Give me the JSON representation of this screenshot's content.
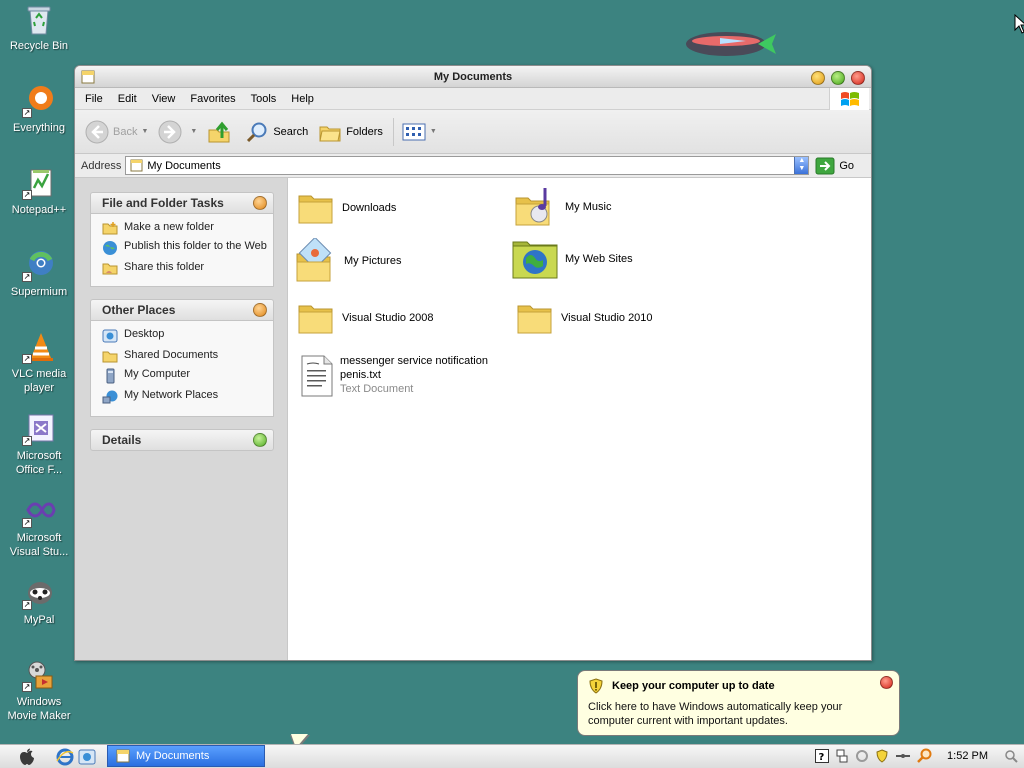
{
  "desktop": {
    "icons": [
      {
        "label": "Recycle Bin",
        "icon": "recycle-bin-icon"
      },
      {
        "label": "Everything",
        "icon": "everything-icon"
      },
      {
        "label": "Notepad++",
        "icon": "notepadpp-icon"
      },
      {
        "label": "Supermium",
        "icon": "supermium-icon"
      },
      {
        "label": "VLC media player",
        "icon": "vlc-icon"
      },
      {
        "label": "Microsoft Office F...",
        "icon": "office-icon"
      },
      {
        "label": "Microsoft Visual Stu...",
        "icon": "visual-studio-icon"
      },
      {
        "label": "MyPal",
        "icon": "mypal-icon"
      },
      {
        "label": "Windows Movie Maker",
        "icon": "movie-maker-icon"
      }
    ]
  },
  "window": {
    "title": "My Documents",
    "menu": [
      "File",
      "Edit",
      "View",
      "Favorites",
      "Tools",
      "Help"
    ],
    "toolbar": {
      "back": "Back",
      "search": "Search",
      "folders": "Folders"
    },
    "address": {
      "label": "Address",
      "value": "My Documents",
      "go": "Go"
    },
    "tasks": {
      "file_folder": {
        "title": "File and Folder Tasks",
        "items": [
          "Make a new folder",
          "Publish this folder to the Web",
          "Share this folder"
        ]
      },
      "other_places": {
        "title": "Other Places",
        "items": [
          "Desktop",
          "Shared Documents",
          "My Computer",
          "My Network Places"
        ]
      },
      "details": {
        "title": "Details"
      }
    },
    "files": [
      {
        "name": "Downloads",
        "icon": "folder-icon"
      },
      {
        "name": "My Music",
        "icon": "music-folder-icon"
      },
      {
        "name": "My Pictures",
        "icon": "pictures-folder-icon"
      },
      {
        "name": "My Web Sites",
        "icon": "web-sites-folder-icon"
      },
      {
        "name": "Visual Studio 2008",
        "icon": "folder-icon"
      },
      {
        "name": "Visual Studio 2010",
        "icon": "folder-icon"
      },
      {
        "name": "messenger service notification penis.txt",
        "type": "Text Document",
        "icon": "text-document-icon"
      }
    ]
  },
  "balloon": {
    "title": "Keep your computer up to date",
    "text": "Click here to have Windows automatically keep your computer current with important updates."
  },
  "taskbar": {
    "active_task": "My Documents",
    "clock": "1:52 PM"
  },
  "colors": {
    "desktop": "#3c8380",
    "task_button": "#2b6fe0",
    "balloon": "#ffffe1"
  }
}
